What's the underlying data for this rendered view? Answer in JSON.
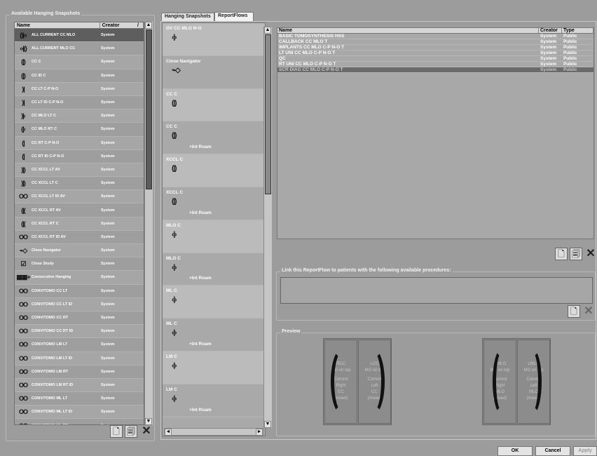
{
  "left": {
    "title": "Available Hanging Snapshots",
    "col_name": "Name",
    "col_creator": "Creator",
    "sort_icon": "/",
    "items": [
      {
        "icon": "()|‹›",
        "name": "ALL CURRENT CC MLO",
        "creator": "System"
      },
      {
        "icon": "‹›|()",
        "name": "ALL CURRENT MLO CC",
        "creator": "System"
      },
      {
        "icon": "(|)",
        "name": "CC C",
        "creator": "System"
      },
      {
        "icon": "(|)",
        "name": "CC ID C",
        "creator": "System"
      },
      {
        "icon": ")|",
        "name": "CC LT C-P N-O",
        "creator": "System"
      },
      {
        "icon": ")|",
        "name": "CC LT ID C-P N-O",
        "creator": "System"
      },
      {
        "icon": ")|‹",
        "name": "CC MLO LT C",
        "creator": "System"
      },
      {
        "icon": "(|‹",
        "name": "CC MLO RT C",
        "creator": "System"
      },
      {
        "icon": "(|",
        "name": "CC RT C-P N-O",
        "creator": "System"
      },
      {
        "icon": "(|",
        "name": "CC RT ID C-P N-O",
        "creator": "System"
      },
      {
        "icon": ")|)",
        "name": "CC XCCL LT AV",
        "creator": "System"
      },
      {
        "icon": ")|)",
        "name": "CC XCCL LT C",
        "creator": "System"
      },
      {
        "icon": "OO",
        "name": "CC XCCL LT ID AV",
        "creator": "System"
      },
      {
        "icon": "(|(",
        "name": "CC XCCL RT AV",
        "creator": "System"
      },
      {
        "icon": "(|(",
        "name": "CC XCCL RT C",
        "creator": "System"
      },
      {
        "icon": "OO",
        "name": "CC XCCL RT ID AV",
        "creator": "System"
      },
      {
        "icon": "⌁◇",
        "name": "Close Navigator",
        "creator": "System"
      },
      {
        "icon": "☑",
        "name": "Close Study",
        "creator": "System"
      },
      {
        "icon": "▦▦+",
        "name": "Consecutive Hanging",
        "creator": "System"
      },
      {
        "icon": "OO",
        "name": "CONV/TOMO CC LT",
        "creator": "System"
      },
      {
        "icon": "OO",
        "name": "CONV/TOMO CC LT ID",
        "creator": "System"
      },
      {
        "icon": "OO",
        "name": "CONV/TOMO CC RT",
        "creator": "System"
      },
      {
        "icon": "OO",
        "name": "CONV/TOMO CC RT ID",
        "creator": "System"
      },
      {
        "icon": "OO",
        "name": "CONV/TOMO LM LT",
        "creator": "System"
      },
      {
        "icon": "OO",
        "name": "CONV/TOMO LM LT ID",
        "creator": "System"
      },
      {
        "icon": "OO",
        "name": "CONV/TOMO LM RT",
        "creator": "System"
      },
      {
        "icon": "OO",
        "name": "CONV/TOMO LM RT ID",
        "creator": "System"
      },
      {
        "icon": "OO",
        "name": "CONV/TOMO ML LT",
        "creator": "System"
      },
      {
        "icon": "OO",
        "name": "CONV/TOMO ML LT ID",
        "creator": "System"
      },
      {
        "icon": "OO",
        "name": "CONV/TOMO ML RT",
        "creator": "System"
      },
      {
        "icon": "OO",
        "name": "CONV/TOMO ML RT ID",
        "creator": "System"
      }
    ]
  },
  "tabs": [
    {
      "label": "Hanging Snapshots"
    },
    {
      "label": "ReportFlows"
    }
  ],
  "flow_steps": [
    {
      "label": "OV CC MLO N-O",
      "icon": "‹|›",
      "extra": ""
    },
    {
      "label": "Close Navigator",
      "icon": "⌁◇",
      "extra": ""
    },
    {
      "label": "CC C",
      "icon": "(|)",
      "extra": ""
    },
    {
      "label": "CC C",
      "icon": "(|)",
      "extra": "+Int Roam"
    },
    {
      "label": "XCCL C",
      "icon": "(|)",
      "extra": ""
    },
    {
      "label": "XCCL C",
      "icon": "(|)",
      "extra": "+Int Roam"
    },
    {
      "label": "MLO C",
      "icon": "‹|›",
      "extra": ""
    },
    {
      "label": "MLO C",
      "icon": "‹|›",
      "extra": "+Int Roam"
    },
    {
      "label": "ML C",
      "icon": "‹|›",
      "extra": ""
    },
    {
      "label": "ML C",
      "icon": "‹|›",
      "extra": "+Int Roam"
    },
    {
      "label": "LM C",
      "icon": "‹|›",
      "extra": ""
    },
    {
      "label": "LM C",
      "icon": "‹|›",
      "extra": "+Int Roam"
    }
  ],
  "reportflows": {
    "col_name": "Name",
    "col_creator": "Creator",
    "col_type": "Type",
    "rows": [
      {
        "name": "BASIC TOMOSYNTHESIS HSS",
        "creator": "System",
        "type": "Public"
      },
      {
        "name": "CALLBACK CC MLO T",
        "creator": "System",
        "type": "Public"
      },
      {
        "name": "IMPLANTS CC MLO C-P N-O T",
        "creator": "System",
        "type": "Public"
      },
      {
        "name": "LT UNI CC MLO C-P N-O T",
        "creator": "System",
        "type": "Public"
      },
      {
        "name": "QC",
        "creator": "System",
        "type": "Public"
      },
      {
        "name": "RT UNI CC MLO C-P N-O T",
        "creator": "System",
        "type": "Public"
      },
      {
        "name": "SCR DIAG CC MLO C-P N-O T",
        "creator": "System",
        "type": "Public"
      }
    ]
  },
  "link_title": "Link this ReportFlow to patients with the following available procedures:",
  "preview": {
    "title": "Preview",
    "cells": [
      {
        "l1": "RCC",
        "l2": "MG on top",
        "l3": "Current",
        "l4": "Right",
        "l5": "CC",
        "l6": "(mixed)"
      },
      {
        "l1": "LCC",
        "l2": "MG on top",
        "l3": "Current",
        "l4": "Left",
        "l5": "CC",
        "l6": "(mixed)"
      },
      {
        "l1": "RMLO",
        "l2": "MG on top",
        "l3": "Current",
        "l4": "Right",
        "l5": "MLO",
        "l6": "(mixed)"
      },
      {
        "l1": "LMLO",
        "l2": "MG on top",
        "l3": "Current",
        "l4": "Left",
        "l5": "MLO",
        "l6": "(mixed)"
      }
    ]
  },
  "buttons": {
    "ok": "OK",
    "cancel": "Cancel",
    "apply": "Apply",
    "new_icon": "new-doc-icon",
    "copy_icon": "copy-doc-icon",
    "delete_icon": "delete-x-icon"
  }
}
